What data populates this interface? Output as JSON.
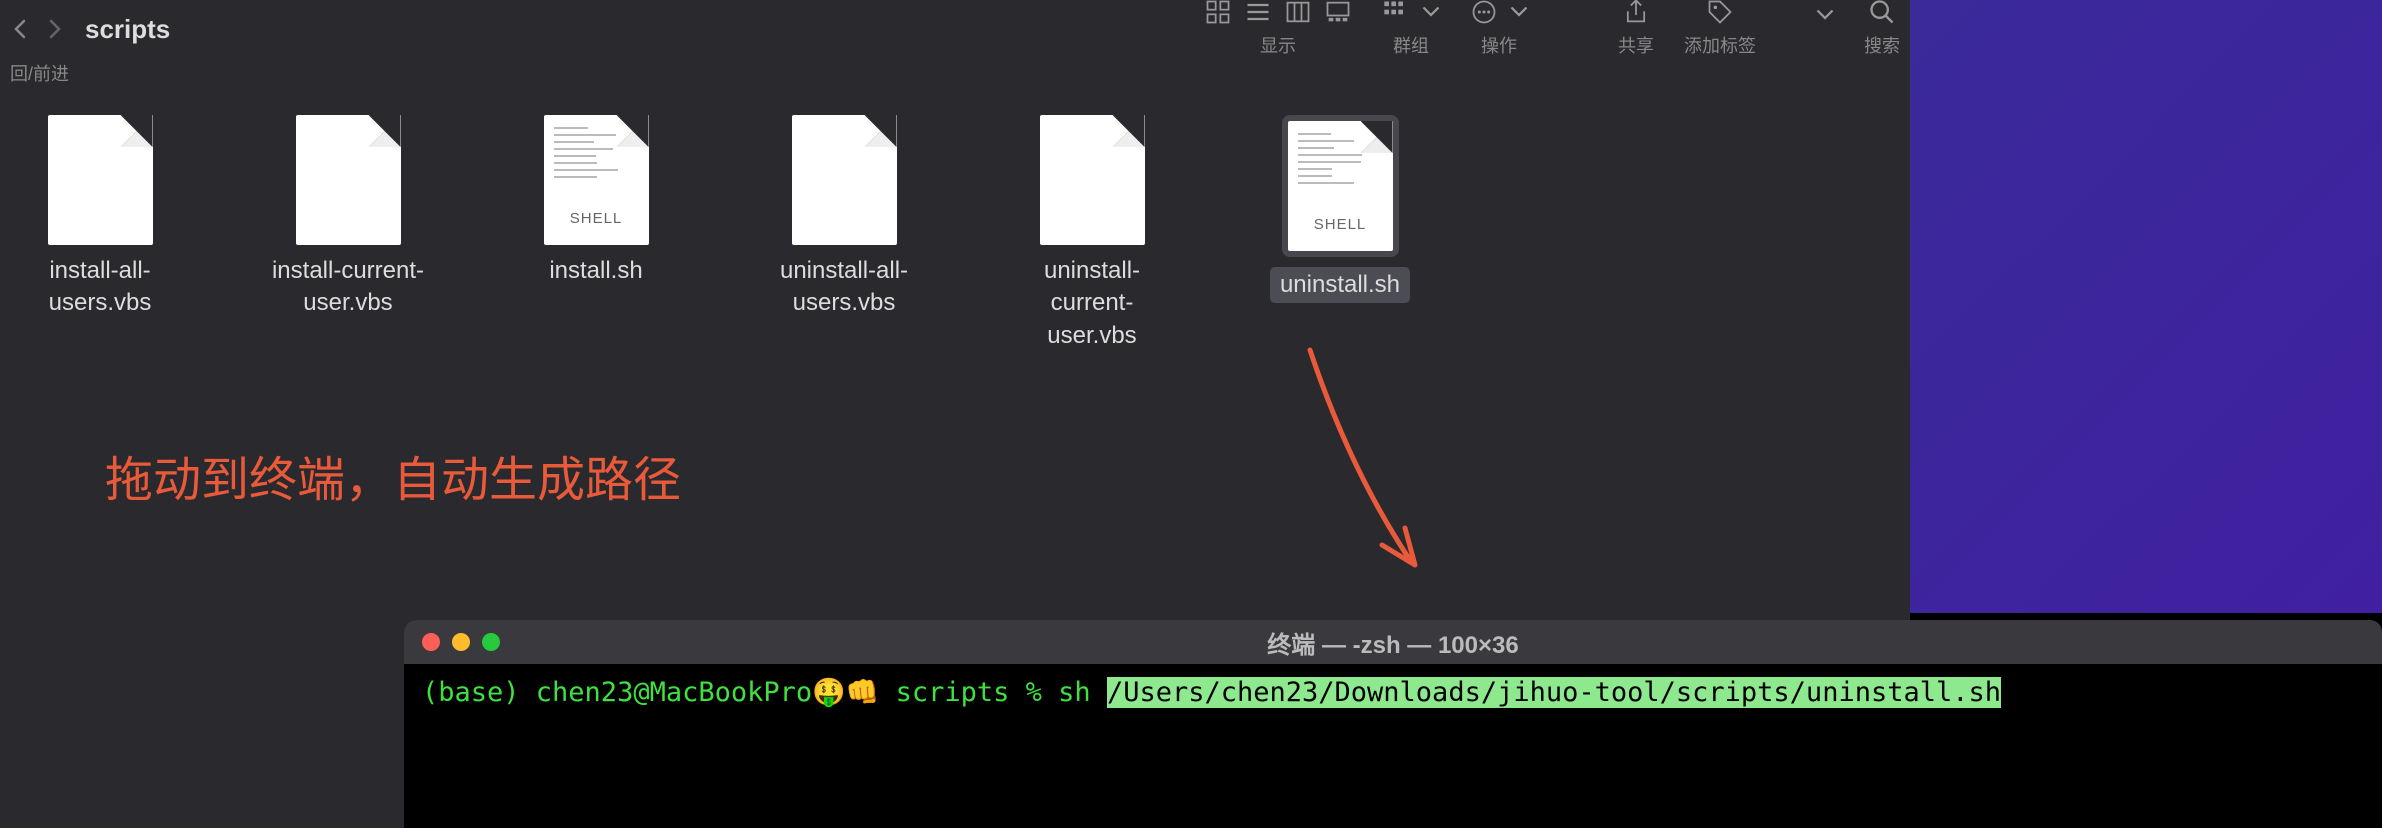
{
  "finder": {
    "title": "scripts",
    "nav_label": "回/前进",
    "toolbar_groups": {
      "display": "显示",
      "group": "群组",
      "action": "操作",
      "share": "共享",
      "tags": "添加标签",
      "search": "搜索"
    }
  },
  "files": [
    {
      "name": "install-all-users.vbs",
      "type": "vbs"
    },
    {
      "name": "install-current-user.vbs",
      "type": "vbs"
    },
    {
      "name": "install.sh",
      "type": "shell"
    },
    {
      "name": "uninstall-all-users.vbs",
      "type": "vbs"
    },
    {
      "name": "uninstall-current-user.vbs",
      "type": "vbs"
    },
    {
      "name": "uninstall.sh",
      "type": "shell",
      "selected": true
    }
  ],
  "shell_badge": "SHELL",
  "annotation": "拖动到终端，自动生成路径",
  "terminal": {
    "title": "终端 — -zsh — 100×36",
    "prompt": "(base) chen23@MacBookPro🤑👊 scripts % sh ",
    "highlighted": "/Users/chen23/Downloads/jihuo-tool/scripts/uninstall.sh"
  }
}
